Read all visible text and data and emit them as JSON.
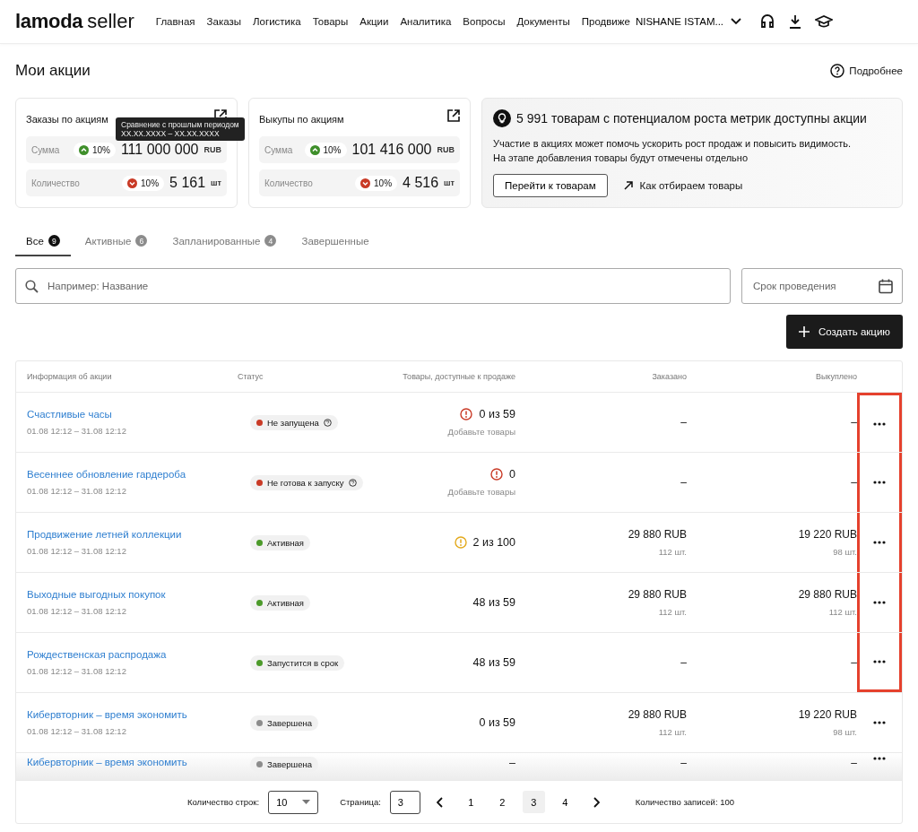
{
  "header": {
    "logo": "lamoda",
    "logo_suffix": "seller",
    "nav": [
      "Главная",
      "Заказы",
      "Логистика",
      "Товары",
      "Акции",
      "Аналитика",
      "Вопросы",
      "Документы",
      "Продвиже"
    ],
    "user": "NISHANE ISTAM..."
  },
  "page": {
    "title": "Мои акции",
    "help": "Подробнее"
  },
  "stat_cards": [
    {
      "title": "Заказы по акциям",
      "rows": [
        {
          "label": "Сумма",
          "kind": "up",
          "percent": "10%",
          "value": "111 000 000",
          "unit": "RUB"
        },
        {
          "label": "Количество",
          "kind": "down",
          "percent": "10%",
          "value": "5 161",
          "unit": "шт"
        }
      ]
    },
    {
      "title": "Выкупы по акциям",
      "rows": [
        {
          "label": "Сумма",
          "kind": "up",
          "percent": "10%",
          "value": "101 416 000",
          "unit": "RUB"
        },
        {
          "label": "Количество",
          "kind": "down",
          "percent": "10%",
          "value": "4 516",
          "unit": "шт"
        }
      ]
    }
  ],
  "tooltip": {
    "title": "Сравнение с прошлым периодом",
    "range": "XX.XX.XXXX – XX.XX.XXXX"
  },
  "promo": {
    "title": "5 991 товарам с потенциалом роста метрик доступны акции",
    "text": "Участие в акциях может помочь ускорить рост продаж и повысить видимость.\nНа этапе добавления товары будут отмечены отдельно",
    "button": "Перейти к товарам",
    "link": "Как отбираем товары"
  },
  "tabs": [
    {
      "label": "Все",
      "count": "9",
      "selected": true
    },
    {
      "label": "Активные",
      "count": "6",
      "selected": false
    },
    {
      "label": "Запланированные",
      "count": "4",
      "selected": false
    },
    {
      "label": "Завершенные",
      "selected": false
    }
  ],
  "search": {
    "placeholder": "Например: Название"
  },
  "date_filter": {
    "placeholder": "Срок проведения"
  },
  "create_button": "Создать акцию",
  "table": {
    "columns": [
      "Информация об акции",
      "Статус",
      "Товары, доступные к продаже",
      "Заказано",
      "Выкуплено"
    ],
    "rows": [
      {
        "name": "Счастливые часы",
        "dates": "01.08 12:12 – 31.08 12:12",
        "status": "Не запущена",
        "color": "#c93a26",
        "status_help": true,
        "alert": {
          "kind": "error"
        },
        "available": "0 из 59",
        "hint": "Добавьте товары",
        "ordered": "–",
        "bought": "–",
        "highlighted": true,
        "faded": false
      },
      {
        "name": "Весеннее обновление гардероба",
        "dates": "01.08 12:12 – 31.08 12:12",
        "status": "Не готова к запуску",
        "color": "#c93a26",
        "status_help": true,
        "alert": {
          "kind": "error"
        },
        "available": "0",
        "hint": "Добавьте товары",
        "ordered": "–",
        "bought": "–",
        "highlighted": true,
        "faded": false
      },
      {
        "name": "Продвижение летней коллекции",
        "dates": "01.08 12:12 – 31.08 12:12",
        "status": "Активная",
        "color": "#4c9a2a",
        "status_help": false,
        "alert": {
          "kind": "warning"
        },
        "available": "2 из 100",
        "ordered": "29 880 RUB",
        "ordered_qty": "112 шт.",
        "bought": "19 220 RUB",
        "bought_qty": "98 шт.",
        "highlighted": true,
        "faded": false
      },
      {
        "name": "Выходные выгодных покупок",
        "dates": "01.08 12:12 – 31.08 12:12",
        "status": "Активная",
        "color": "#4c9a2a",
        "status_help": false,
        "available": "48 из 59",
        "ordered": "29 880 RUB",
        "ordered_qty": "112 шт.",
        "bought": "29 880 RUB",
        "bought_qty": "112 шт.",
        "highlighted": true,
        "faded": false
      },
      {
        "name": "Рождественская распродажа",
        "dates": "01.08 12:12 – 31.08 12:12",
        "status": "Запустится в срок",
        "color": "#4c9a2a",
        "status_help": false,
        "available": "48 из 59",
        "ordered": "–",
        "bought": "–",
        "highlighted": true,
        "faded": false
      },
      {
        "name": "Кибервторник – время экономить",
        "dates": "01.08 12:12 – 31.08 12:12",
        "status": "Завершена",
        "color": "#8c8c8c",
        "status_help": false,
        "available": "0 из 59",
        "ordered": "29 880 RUB",
        "ordered_qty": "112 шт.",
        "bought": "19 220 RUB",
        "bought_qty": "98 шт.",
        "highlighted": false,
        "faded": false
      },
      {
        "name": "Кибервторник – время экономить",
        "status": "Завершена",
        "color": "#8c8c8c",
        "status_help": false,
        "available": "–",
        "ordered": "–",
        "bought": "–",
        "highlighted": false,
        "faded": true
      }
    ]
  },
  "pagination": {
    "rows_label": "Количество строк:",
    "rows_value": "10",
    "page_label": "Страница:",
    "page_value": "3",
    "pages": [
      {
        "label": "1",
        "selected": false
      },
      {
        "label": "2",
        "selected": false
      },
      {
        "label": "3",
        "selected": true
      },
      {
        "label": "4",
        "selected": false
      }
    ],
    "total": "Количество записей: 100"
  }
}
